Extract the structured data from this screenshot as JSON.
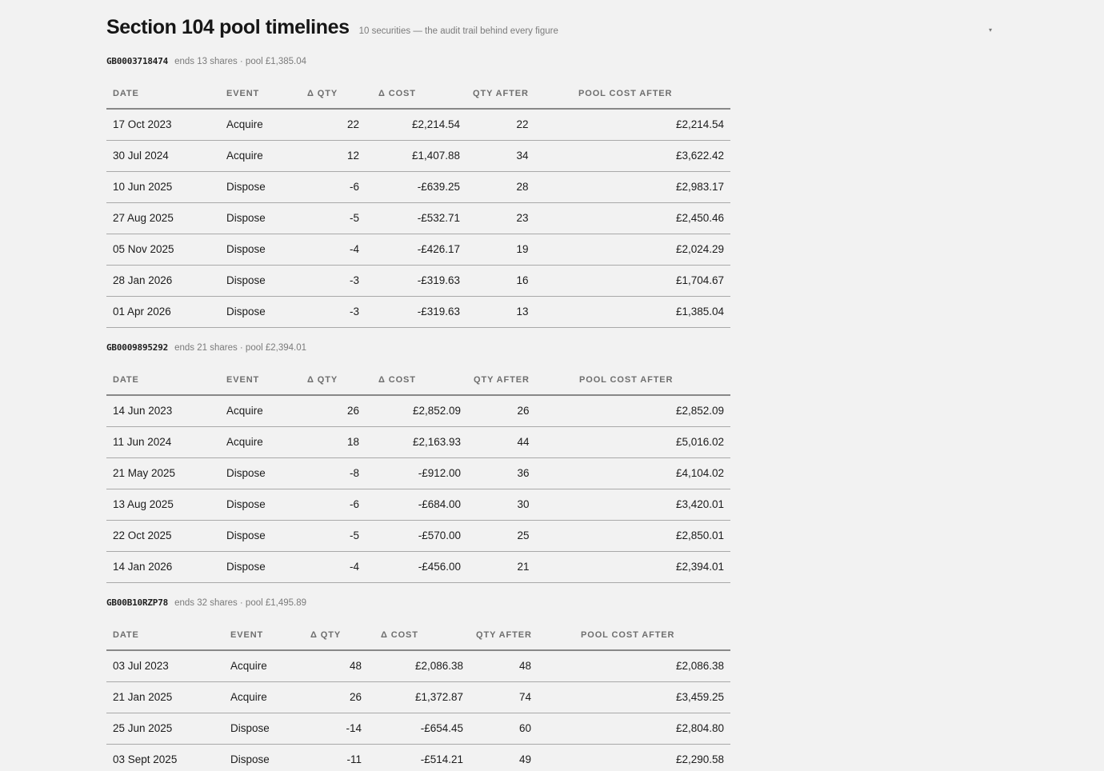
{
  "header": {
    "title": "Section 104 pool timelines",
    "subtitle": "10 securities — the audit trail behind every figure",
    "collapse_glyph": "▾"
  },
  "columns": {
    "date": "DATE",
    "event": "EVENT",
    "dqty": "Δ QTY",
    "dcost": "Δ COST",
    "qty_after": "QTY AFTER",
    "pool_after": "POOL COST AFTER"
  },
  "securities": [
    {
      "isin": "GB0003718474",
      "summary": "ends 13 shares · pool £1,385.04",
      "rows": [
        {
          "date": "17 Oct 2023",
          "event": "Acquire",
          "dqty": "22",
          "dcost": "£2,214.54",
          "qty_after": "22",
          "pool_after": "£2,214.54"
        },
        {
          "date": "30 Jul 2024",
          "event": "Acquire",
          "dqty": "12",
          "dcost": "£1,407.88",
          "qty_after": "34",
          "pool_after": "£3,622.42"
        },
        {
          "date": "10 Jun 2025",
          "event": "Dispose",
          "dqty": "-6",
          "dcost": "-£639.25",
          "qty_after": "28",
          "pool_after": "£2,983.17"
        },
        {
          "date": "27 Aug 2025",
          "event": "Dispose",
          "dqty": "-5",
          "dcost": "-£532.71",
          "qty_after": "23",
          "pool_after": "£2,450.46"
        },
        {
          "date": "05 Nov 2025",
          "event": "Dispose",
          "dqty": "-4",
          "dcost": "-£426.17",
          "qty_after": "19",
          "pool_after": "£2,024.29"
        },
        {
          "date": "28 Jan 2026",
          "event": "Dispose",
          "dqty": "-3",
          "dcost": "-£319.63",
          "qty_after": "16",
          "pool_after": "£1,704.67"
        },
        {
          "date": "01 Apr 2026",
          "event": "Dispose",
          "dqty": "-3",
          "dcost": "-£319.63",
          "qty_after": "13",
          "pool_after": "£1,385.04"
        }
      ]
    },
    {
      "isin": "GB0009895292",
      "summary": "ends 21 shares · pool £2,394.01",
      "rows": [
        {
          "date": "14 Jun 2023",
          "event": "Acquire",
          "dqty": "26",
          "dcost": "£2,852.09",
          "qty_after": "26",
          "pool_after": "£2,852.09"
        },
        {
          "date": "11 Jun 2024",
          "event": "Acquire",
          "dqty": "18",
          "dcost": "£2,163.93",
          "qty_after": "44",
          "pool_after": "£5,016.02"
        },
        {
          "date": "21 May 2025",
          "event": "Dispose",
          "dqty": "-8",
          "dcost": "-£912.00",
          "qty_after": "36",
          "pool_after": "£4,104.02"
        },
        {
          "date": "13 Aug 2025",
          "event": "Dispose",
          "dqty": "-6",
          "dcost": "-£684.00",
          "qty_after": "30",
          "pool_after": "£3,420.01"
        },
        {
          "date": "22 Oct 2025",
          "event": "Dispose",
          "dqty": "-5",
          "dcost": "-£570.00",
          "qty_after": "25",
          "pool_after": "£2,850.01"
        },
        {
          "date": "14 Jan 2026",
          "event": "Dispose",
          "dqty": "-4",
          "dcost": "-£456.00",
          "qty_after": "21",
          "pool_after": "£2,394.01"
        }
      ]
    },
    {
      "isin": "GB00B10RZP78",
      "summary": "ends 32 shares · pool £1,495.89",
      "rows": [
        {
          "date": "03 Jul 2023",
          "event": "Acquire",
          "dqty": "48",
          "dcost": "£2,086.38",
          "qty_after": "48",
          "pool_after": "£2,086.38"
        },
        {
          "date": "21 Jan 2025",
          "event": "Acquire",
          "dqty": "26",
          "dcost": "£1,372.87",
          "qty_after": "74",
          "pool_after": "£3,459.25"
        },
        {
          "date": "25 Jun 2025",
          "event": "Dispose",
          "dqty": "-14",
          "dcost": "-£654.45",
          "qty_after": "60",
          "pool_after": "£2,804.80"
        },
        {
          "date": "03 Sept 2025",
          "event": "Dispose",
          "dqty": "-11",
          "dcost": "-£514.21",
          "qty_after": "49",
          "pool_after": "£2,290.58"
        }
      ]
    }
  ]
}
